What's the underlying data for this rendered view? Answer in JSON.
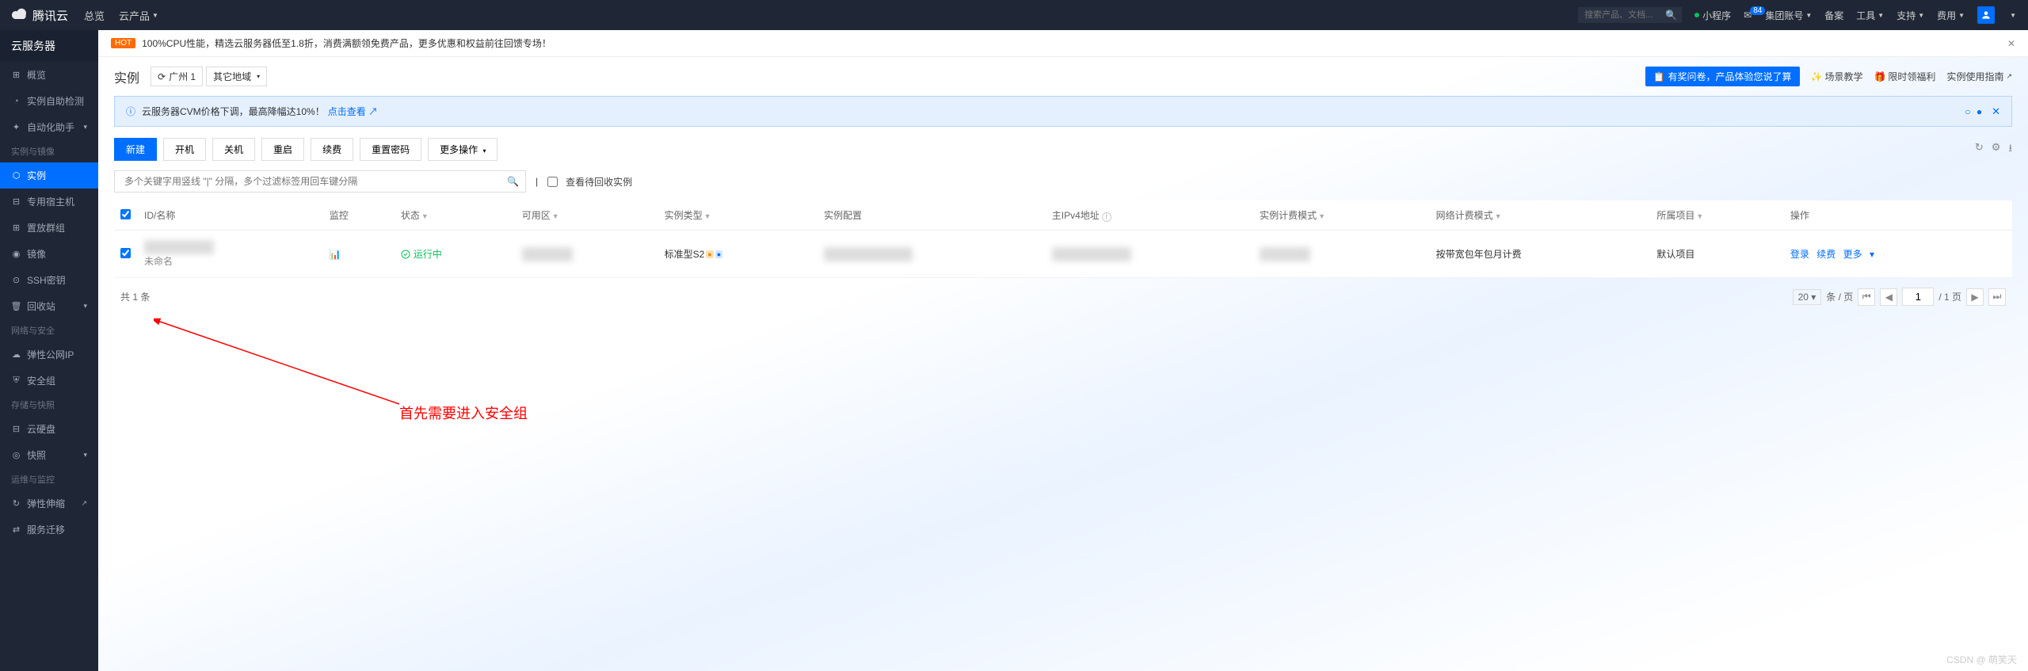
{
  "top": {
    "brand": "腾讯云",
    "nav": [
      "总览",
      "云产品"
    ],
    "search_placeholder": "搜索产品、文档...",
    "mini_program": "小程序",
    "account_label": "集团账号",
    "badge_count": "84",
    "right_links": [
      "备案",
      "工具",
      "支持",
      "费用"
    ]
  },
  "sidebar": {
    "title": "云服务器",
    "items": [
      {
        "icon": "⊞",
        "label": "概览"
      },
      {
        "icon": "◔",
        "label": "实例自助检测"
      },
      {
        "icon": "✦",
        "label": "自动化助手",
        "arrow": true
      }
    ],
    "group1": "实例与镜像",
    "items2": [
      {
        "icon": "⬡",
        "label": "实例",
        "active": true
      },
      {
        "icon": "⊟",
        "label": "专用宿主机"
      },
      {
        "icon": "⊞",
        "label": "置放群组"
      },
      {
        "icon": "◉",
        "label": "镜像"
      },
      {
        "icon": "⊙",
        "label": "SSH密钥"
      },
      {
        "icon": "🗑",
        "label": "回收站",
        "arrow": true
      }
    ],
    "group2": "网络与安全",
    "items3": [
      {
        "icon": "☁",
        "label": "弹性公网IP"
      },
      {
        "icon": "⛨",
        "label": "安全组"
      }
    ],
    "group3": "存储与快照",
    "items4": [
      {
        "icon": "⊟",
        "label": "云硬盘"
      },
      {
        "icon": "◎",
        "label": "快照",
        "arrow": true
      }
    ],
    "group4": "运维与监控",
    "items5": [
      {
        "icon": "↻",
        "label": "弹性伸缩"
      },
      {
        "icon": "⇄",
        "label": "服务迁移"
      }
    ]
  },
  "hot": {
    "tag": "HOT",
    "text": "100%CPU性能，精选云服务器低至1.8折，消费满额领免费产品，更多优惠和权益前往回馈专场！"
  },
  "page": {
    "title": "实例",
    "region_icon": "⟳",
    "region": "广州 1",
    "other_region": "其它地域",
    "help_pill": "有奖问卷，产品体验您说了算",
    "links": [
      "场景教学",
      "限时领福利",
      "实例使用指南"
    ]
  },
  "infobar": {
    "text": "云服务器CVM价格下调，最高降幅达10%！",
    "link": "点击查看"
  },
  "toolbar": {
    "primary": "新建",
    "buttons": [
      "开机",
      "关机",
      "重启",
      "续费",
      "重置密码"
    ],
    "more": "更多操作"
  },
  "search": {
    "placeholder": "多个关键字用竖线 \"|\" 分隔，多个过滤标签用回车键分隔",
    "recycle": "查看待回收实例"
  },
  "table": {
    "headers": [
      "ID/名称",
      "监控",
      "状态",
      "可用区",
      "实例类型",
      "实例配置",
      "主IPv4地址",
      "实例计费模式",
      "网络计费模式",
      "所属项目",
      "操作"
    ],
    "row": {
      "name_sub": "未命名",
      "status": "运行中",
      "type": "标准型S2",
      "billing": "按带宽包年包月计费",
      "project": "默认项目",
      "actions": [
        "登录",
        "续费",
        "更多"
      ]
    },
    "footer_total": "共 1 条",
    "page_size": "20",
    "per_page": "条 / 页",
    "page_input": "1",
    "page_total": "/ 1 页"
  },
  "annotation": "首先需要进入安全组",
  "watermark": "CSDN @ 萌笑天"
}
